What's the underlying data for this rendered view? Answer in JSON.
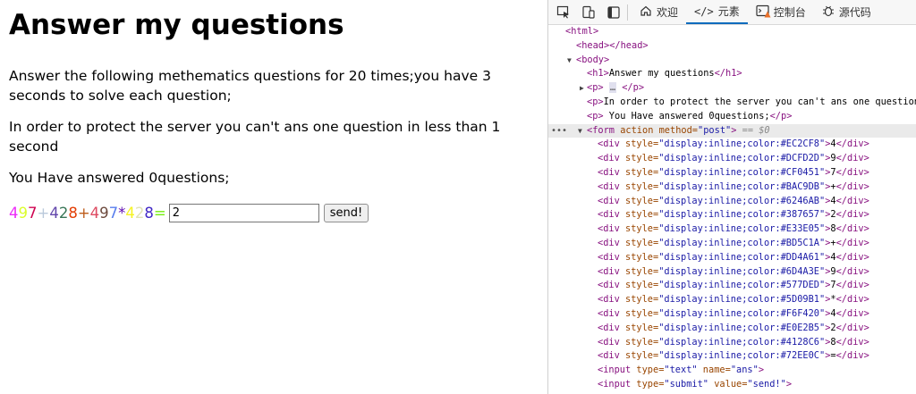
{
  "page": {
    "heading": "Answer my questions",
    "p1": "Answer the following methematics questions for 20 times;you have 3 seconds to solve each question;",
    "p2": "In order to protect the server you can't ans one question in less than 1 second",
    "p3": "You Have answered 0questions;",
    "question_chars": [
      {
        "ch": "4",
        "color": "#EC2CF8"
      },
      {
        "ch": "9",
        "color": "#DCFD2D"
      },
      {
        "ch": "7",
        "color": "#CF0451"
      },
      {
        "ch": "+",
        "color": "#BAC9DB"
      },
      {
        "ch": "4",
        "color": "#6246AB"
      },
      {
        "ch": "2",
        "color": "#387657"
      },
      {
        "ch": "8",
        "color": "#E33E05"
      },
      {
        "ch": "+",
        "color": "#BD5C1A"
      },
      {
        "ch": "4",
        "color": "#DD4A61"
      },
      {
        "ch": "9",
        "color": "#6D4A3E"
      },
      {
        "ch": "7",
        "color": "#577DED"
      },
      {
        "ch": "*",
        "color": "#5D09B1"
      },
      {
        "ch": "4",
        "color": "#F6F420"
      },
      {
        "ch": "2",
        "color": "#E0E2B5"
      },
      {
        "ch": "8",
        "color": "#4128C6"
      },
      {
        "ch": "=",
        "color": "#72EE0C"
      }
    ],
    "answer_value": "2",
    "send_label": "send!"
  },
  "devtools": {
    "tabs": [
      {
        "icon": "home-icon",
        "label": "欢迎"
      },
      {
        "icon": "code-icon",
        "label": "元素",
        "active": true
      },
      {
        "icon": "console-icon",
        "label": "控制台"
      },
      {
        "icon": "bug-icon",
        "label": "源代码"
      }
    ],
    "tree": {
      "html_open": "<html>",
      "head": "<head></head>",
      "body_open": "<body>",
      "h1_open": "<h1>",
      "h1_text": "Answer my questions",
      "h1_close": "</h1>",
      "p_open": "<p>",
      "p_ellipsis": "…",
      "p_close": "</p>",
      "p2_open": "<p>",
      "p2_text": "In order to protect the server you can't ans one question",
      "p3_open": "<p>",
      "p3_text": " You Have answered 0questions;",
      "p3_close": "</p>",
      "form_open": "<form",
      "form_attr1": " action",
      "form_attr2": " method=",
      "form_val": "\"post\"",
      "form_end": ">",
      "form_marker": " == $0",
      "div_open": "<div",
      "div_attr": " style=",
      "div_close": "</div>",
      "input_text": "<input type=\"text\" name=\"ans\">",
      "input_submit": "<input type=\"submit\" value=\"send!\">",
      "input_tag": "<input",
      "type_attr": " type=",
      "name_attr": " name=",
      "value_attr": " value=",
      "text_val": "\"text\"",
      "ans_val": "\"ans\"",
      "submit_val": "\"submit\"",
      "send_val": "\"send!\"",
      "close_gt": ">"
    }
  }
}
